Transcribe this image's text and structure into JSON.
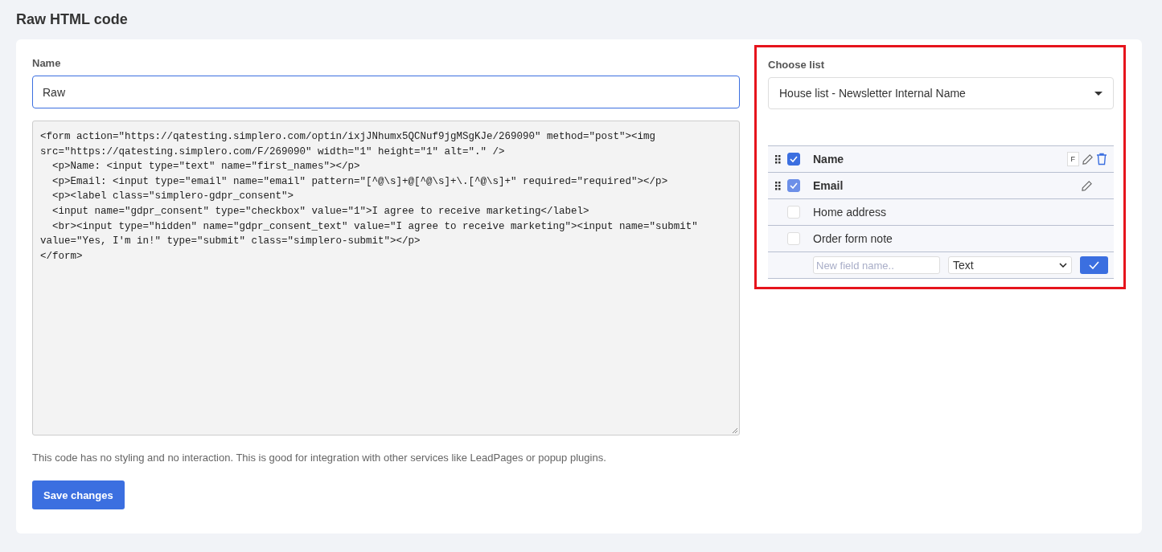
{
  "page_title": "Raw HTML code",
  "name_field": {
    "label": "Name",
    "value": "Raw"
  },
  "code_lines": [
    "<form action=\"https://qatesting.simplero.com/optin/ixjJNhumx5QCNuf9jgMSgKJe/269090\" method=\"post\"><img",
    "src=\"https://qatesting.simplero.com/F/269090\" width=\"1\" height=\"1\" alt=\".\" />",
    "  <p>Name: <input type=\"text\" name=\"first_names\"></p>",
    "  <p>Email: <input type=\"email\" name=\"email\" pattern=\"[^@\\s]+@[^@\\s]+\\.[^@\\s]+\" required=\"required\"></p>",
    "  <p><label class=\"simplero-gdpr_consent\">",
    "  <input name=\"gdpr_consent\" type=\"checkbox\" value=\"1\">I agree to receive marketing</label>",
    "  <br><input type=\"hidden\" name=\"gdpr_consent_text\" value=\"I agree to receive marketing\"><input name=\"submit\"",
    "value=\"Yes, I'm in!\" type=\"submit\" class=\"simplero-submit\"></p>",
    "</form>"
  ],
  "help_text": "This code has no styling and no interaction. This is good for integration with other services like LeadPages or popup plugins.",
  "save_button": "Save changes",
  "list_panel": {
    "highlighted": true,
    "label": "Choose list",
    "value": "House list - Newsletter Internal Name"
  },
  "fields": [
    {
      "label": "Name",
      "checked": true,
      "disabled": false,
      "draggable": true,
      "badge": "F",
      "editable": true,
      "deletable": true
    },
    {
      "label": "Email",
      "checked": true,
      "disabled": true,
      "draggable": true,
      "editable": true,
      "deletable": false
    },
    {
      "label": "Home address",
      "checked": false,
      "disabled": false,
      "draggable": false,
      "editable": false,
      "deletable": false
    },
    {
      "label": "Order form note",
      "checked": false,
      "disabled": false,
      "draggable": false,
      "editable": false,
      "deletable": false
    }
  ],
  "new_field": {
    "placeholder": "New field name..",
    "type_value": "Text"
  }
}
